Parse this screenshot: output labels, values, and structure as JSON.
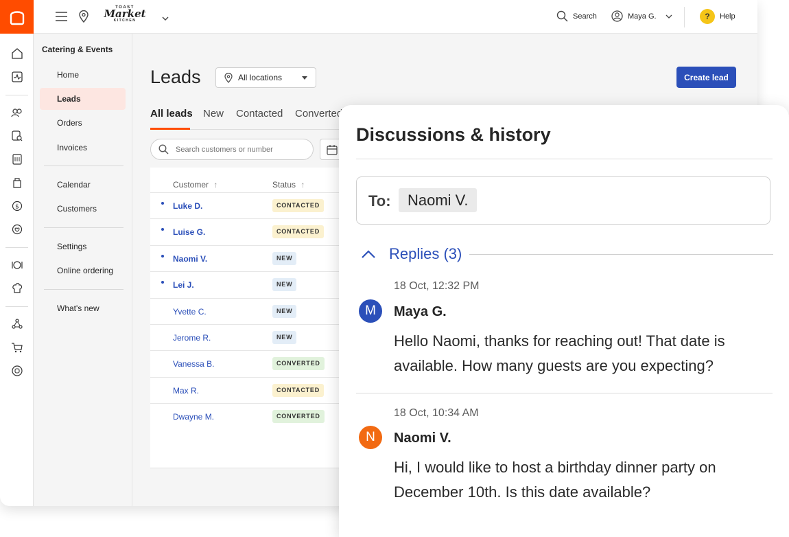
{
  "topbar": {
    "brand_top": "TOAST",
    "brand_name": "Market",
    "brand_bottom": "KITCHEN",
    "search_label": "Search",
    "user_label": "Maya G.",
    "help_label": "Help",
    "help_icon_glyph": "?"
  },
  "sidebar": {
    "section_title": "Catering & Events",
    "items": [
      {
        "label": "Home"
      },
      {
        "label": "Leads"
      },
      {
        "label": "Orders"
      },
      {
        "label": "Invoices"
      },
      {
        "label": "Calendar"
      },
      {
        "label": "Customers"
      },
      {
        "label": "Settings"
      },
      {
        "label": "Online ordering"
      },
      {
        "label": "What's new"
      }
    ],
    "active_item": "Leads"
  },
  "main": {
    "page_title": "Leads",
    "location_select": "All locations",
    "create_button": "Create lead",
    "tabs": [
      {
        "label": "All leads"
      },
      {
        "label": "New"
      },
      {
        "label": "Contacted"
      },
      {
        "label": "Converted"
      }
    ],
    "search_placeholder": "Search customers or number",
    "table": {
      "headers": {
        "customer": "Customer",
        "status": "Status"
      },
      "rows": [
        {
          "customer": "Luke D.",
          "status": "CONTACTED",
          "unread": true
        },
        {
          "customer": "Luise G.",
          "status": "CONTACTED",
          "unread": true
        },
        {
          "customer": "Naomi V.",
          "status": "NEW",
          "unread": true
        },
        {
          "customer": "Lei J.",
          "status": "NEW",
          "unread": true
        },
        {
          "customer": "Yvette C.",
          "status": "NEW",
          "unread": false
        },
        {
          "customer": "Jerome R.",
          "status": "NEW",
          "unread": false
        },
        {
          "customer": "Vanessa B.",
          "status": "CONVERTED",
          "unread": false
        },
        {
          "customer": "Max R.",
          "status": "CONTACTED",
          "unread": false
        },
        {
          "customer": "Dwayne M.",
          "status": "CONVERTED",
          "unread": false
        }
      ]
    }
  },
  "panel": {
    "title": "Discussions & history",
    "to_label": "To:",
    "to_recipient": "Naomi V.",
    "replies_label": "Replies (3)",
    "messages": [
      {
        "time": "18 Oct, 12:32 PM",
        "initial": "M",
        "author": "Maya G.",
        "body": "Hello Naomi, thanks for reaching out! That date is available. How many guests are you expecting?"
      },
      {
        "time": "18 Oct, 10:34 AM",
        "initial": "N",
        "author": "Naomi V.",
        "body": "Hi, I would like to host a birthday dinner party on December 10th. Is this date available?"
      }
    ]
  },
  "colors": {
    "brand_orange": "#ff4c00",
    "primary_blue": "#2b4fb9",
    "badge_contacted": "#fbf1cf",
    "badge_new": "#e3edf7",
    "badge_converted": "#e1f2dc",
    "avatar_maya": "#2b4fb9",
    "avatar_naomi": "#f26a12"
  }
}
